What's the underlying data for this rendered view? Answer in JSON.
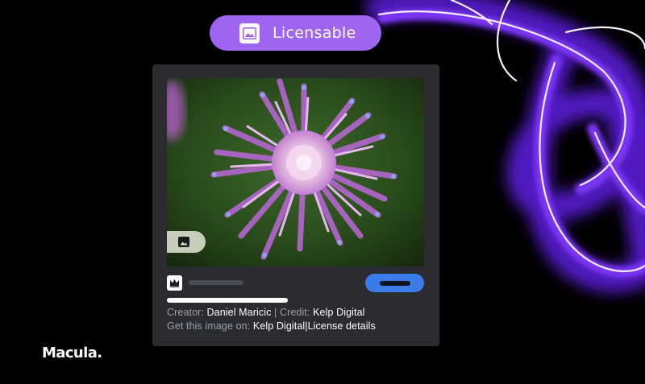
{
  "badge": {
    "label": "Licensable",
    "icon": "image-icon"
  },
  "card": {
    "photo": {
      "subject": "flower-photo",
      "badge_icon": "image-icon"
    },
    "creator_label": "Creator:",
    "creator_name": "Daniel Maricic",
    "separator": "|",
    "credit_label": "Credit:",
    "credit_name": "Kelp Digital",
    "get_label": "Get this image on:",
    "get_source": "Kelp Digital",
    "pipe": "|",
    "license_link": "License details",
    "crown_icon": "crown-icon"
  },
  "brand": {
    "logo": "Macula."
  },
  "colors": {
    "background": "#000000",
    "card": "#2b2c31",
    "pill": "#a065f0",
    "button": "#3c7ce8",
    "neon": "#7a2df0"
  }
}
